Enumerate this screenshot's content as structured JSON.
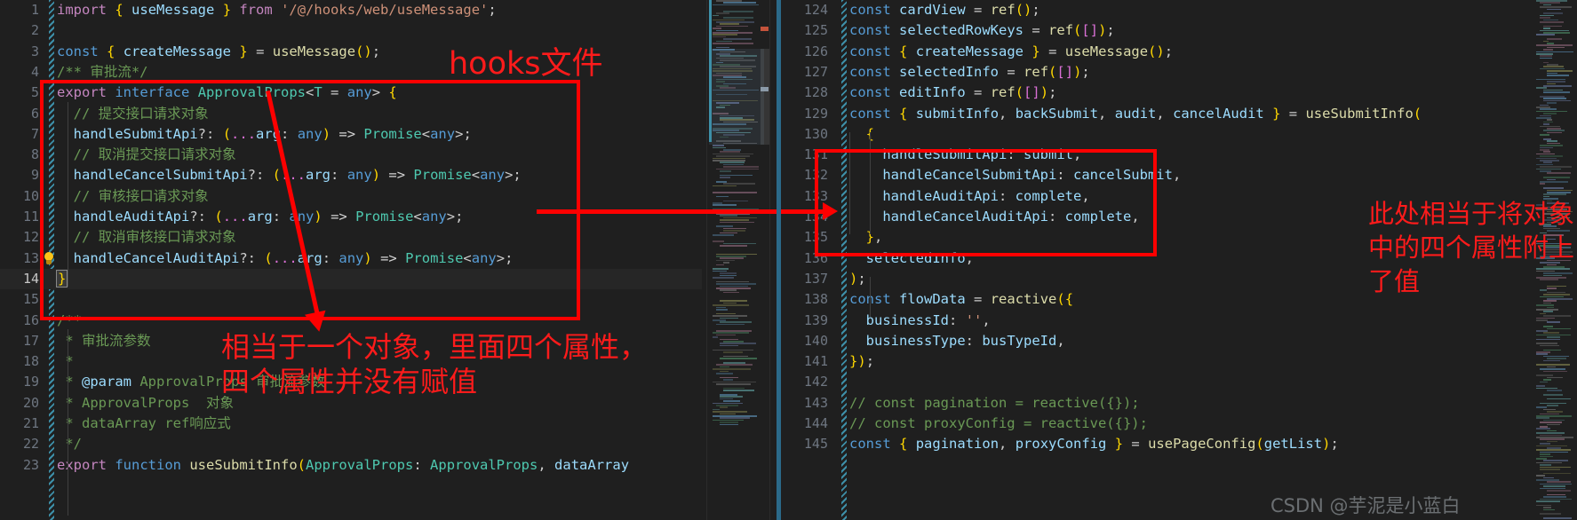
{
  "editor": {
    "theme_bg": "#1f1f1f",
    "accent_red": "#fe0000",
    "left_pane": {
      "name": "hooks-source-file",
      "first_line": 1,
      "current_line": 14,
      "lines": [
        {
          "n": 1,
          "text": "import { useMessage } from '/@/hooks/web/useMessage';"
        },
        {
          "n": 2,
          "text": ""
        },
        {
          "n": 3,
          "text": "const { createMessage } = useMessage();"
        },
        {
          "n": 4,
          "text": "/** 审批流*/"
        },
        {
          "n": 5,
          "text": "export interface ApprovalProps<T = any> {"
        },
        {
          "n": 6,
          "text": "  // 提交接口请求对象"
        },
        {
          "n": 7,
          "text": "  handleSubmitApi?: (...arg: any) => Promise<any>;"
        },
        {
          "n": 8,
          "text": "  // 取消提交接口请求对象"
        },
        {
          "n": 9,
          "text": "  handleCancelSubmitApi?: (...arg: any) => Promise<any>;"
        },
        {
          "n": 10,
          "text": "  // 审核接口请求对象"
        },
        {
          "n": 11,
          "text": "  handleAuditApi?: (...arg: any) => Promise<any>;"
        },
        {
          "n": 12,
          "text": "  // 取消审核接口请求对象"
        },
        {
          "n": 13,
          "text": "  handleCancelAuditApi?: (...arg: any) => Promise<any>;"
        },
        {
          "n": 14,
          "text": "}"
        },
        {
          "n": 15,
          "text": ""
        },
        {
          "n": 16,
          "text": "/**"
        },
        {
          "n": 17,
          "text": " * 审批流参数"
        },
        {
          "n": 18,
          "text": " *"
        },
        {
          "n": 19,
          "text": " * @param ApprovalProps 审批流参数"
        },
        {
          "n": 20,
          "text": " * ApprovalProps  对象"
        },
        {
          "n": 21,
          "text": " * dataArray ref响应式"
        },
        {
          "n": 22,
          "text": " */"
        },
        {
          "n": 23,
          "text": "export function useSubmitInfo(ApprovalProps: ApprovalProps, dataArray"
        }
      ]
    },
    "right_pane": {
      "name": "component-setup-file",
      "first_line": 124,
      "lines": [
        {
          "n": 124,
          "text": "const cardView = ref();"
        },
        {
          "n": 125,
          "text": "const selectedRowKeys = ref([]);"
        },
        {
          "n": 126,
          "text": "const { createMessage } = useMessage();"
        },
        {
          "n": 127,
          "text": "const selectedInfo = ref([]);"
        },
        {
          "n": 128,
          "text": "const editInfo = ref([]);"
        },
        {
          "n": 129,
          "text": "const { submitInfo, backSubmit, audit, cancelAudit } = useSubmitInfo("
        },
        {
          "n": 130,
          "text": "  {"
        },
        {
          "n": 131,
          "text": "    handleSubmitApi: submit,"
        },
        {
          "n": 132,
          "text": "    handleCancelSubmitApi: cancelSubmit,"
        },
        {
          "n": 133,
          "text": "    handleAuditApi: complete,"
        },
        {
          "n": 134,
          "text": "    handleCancelAuditApi: complete,"
        },
        {
          "n": 135,
          "text": "  },"
        },
        {
          "n": 136,
          "text": "  selectedInfo,"
        },
        {
          "n": 137,
          "text": ");"
        },
        {
          "n": 138,
          "text": "const flowData = reactive({"
        },
        {
          "n": 139,
          "text": "  businessId: '',"
        },
        {
          "n": 140,
          "text": "  businessType: busTypeId,"
        },
        {
          "n": 141,
          "text": "});"
        },
        {
          "n": 142,
          "text": ""
        },
        {
          "n": 143,
          "text": "// const pagination = reactive({});"
        },
        {
          "n": 144,
          "text": "// const proxyConfig = reactive({});"
        },
        {
          "n": 145,
          "text": "const { pagination, proxyConfig } = usePageConfig(getList);"
        }
      ]
    }
  },
  "annotations": {
    "label_hooks_file": "hooks文件",
    "label_left_note_line1": "相当于一个对象，里面四个属性，",
    "label_left_note_line2": "四个属性并没有赋值",
    "label_right_note_line1": "此处相当于将对象",
    "label_right_note_line2": "中的四个属性附上",
    "label_right_note_line3": "了值",
    "box_left_name": "interface-highlight-box",
    "box_right_name": "object-literal-highlight-box"
  },
  "watermark": {
    "text": "CSDN @芋泥是小蓝白"
  }
}
